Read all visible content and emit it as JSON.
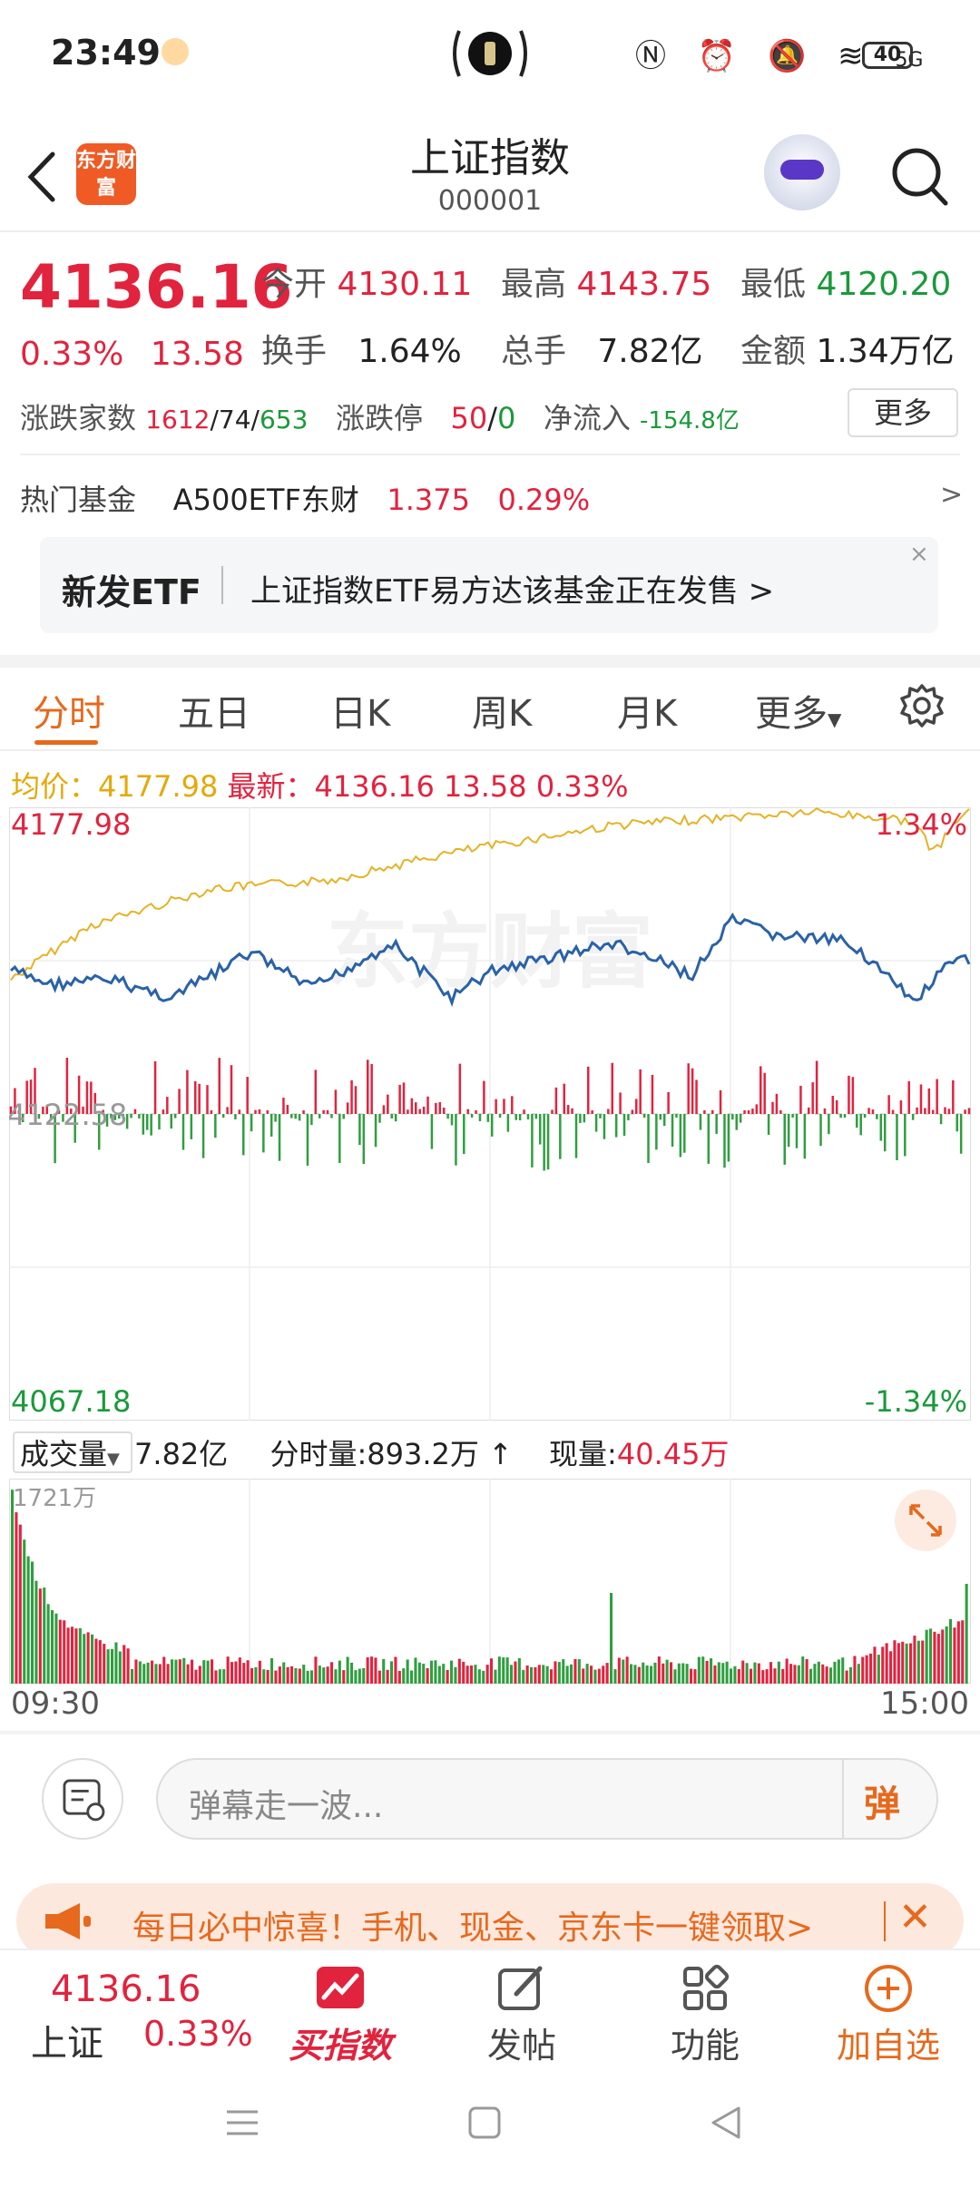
{
  "status_bar": {
    "time": "23:49",
    "network": "5G",
    "battery": "40"
  },
  "header": {
    "back_icon": "back-arrow-icon",
    "logo_text": "东方财富",
    "title": "上证指数",
    "code": "000001"
  },
  "quote": {
    "price": "4136.16",
    "change_pct": "0.33%",
    "change": "13.58",
    "open_label": "今开",
    "open": "4130.11",
    "high_label": "最高",
    "high": "4143.75",
    "low_label": "最低",
    "low": "4120.20",
    "turnover_label": "换手",
    "turnover": "1.64%",
    "volume_label": "总手",
    "volume": "7.82亿",
    "amount_label": "金额",
    "amount": "1.34万亿",
    "advdec_label": "涨跌家数",
    "adv": "1612",
    "flat": "74",
    "dec": "653",
    "limit_label": "涨跌停",
    "limit_up": "50",
    "limit_down": "0",
    "netflow_label": "净流入",
    "netflow": "-154.8亿",
    "more_label": "更多"
  },
  "hot_fund": {
    "label": "热门基金",
    "name": "A500ETF东财",
    "price": "1.375",
    "change": "0.29%",
    "arrow": ">"
  },
  "etf_banner": {
    "tag": "新发ETF",
    "text": "上证指数ETF易方达该基金正在发售 >",
    "close": "×"
  },
  "tabs": {
    "items": [
      "分时",
      "五日",
      "日K",
      "周K",
      "月K",
      "更多"
    ],
    "active": 0
  },
  "avg_line": {
    "avg_label": "均价：",
    "avg": "4177.98",
    "last_label": "最新：",
    "last": "4136.16",
    "chg": "13.58",
    "pct": "0.33%"
  },
  "chart": {
    "y_top": "4177.98",
    "y_mid": "4122.58",
    "y_bot": "4067.18",
    "pct_top": "1.34%",
    "pct_bot": "-1.34%",
    "watermark": "东方财富",
    "colors": {
      "price": "#2a62a8",
      "avg": "#e5b227",
      "up": "#e2233e",
      "down": "#2f9e3f"
    }
  },
  "volume": {
    "select_label": "成交量",
    "total": "7.82亿",
    "min_vol_label": "分时量:",
    "min_vol": "893.2万",
    "cur_label": "现量:",
    "cur": "40.45万",
    "max": "1721万",
    "t_start": "09:30",
    "t_end": "15:00"
  },
  "danmu": {
    "placeholder": "弹幕走一波...",
    "button": "弹"
  },
  "promo": {
    "text": "每日必中惊喜！手机、现金、京东卡一键领取>",
    "close": "✕"
  },
  "bottom_bar": {
    "price": "4136.16",
    "name": "上证",
    "pct": "0.33%",
    "items": [
      "买指数",
      "发帖",
      "功能",
      "加自选"
    ]
  }
}
